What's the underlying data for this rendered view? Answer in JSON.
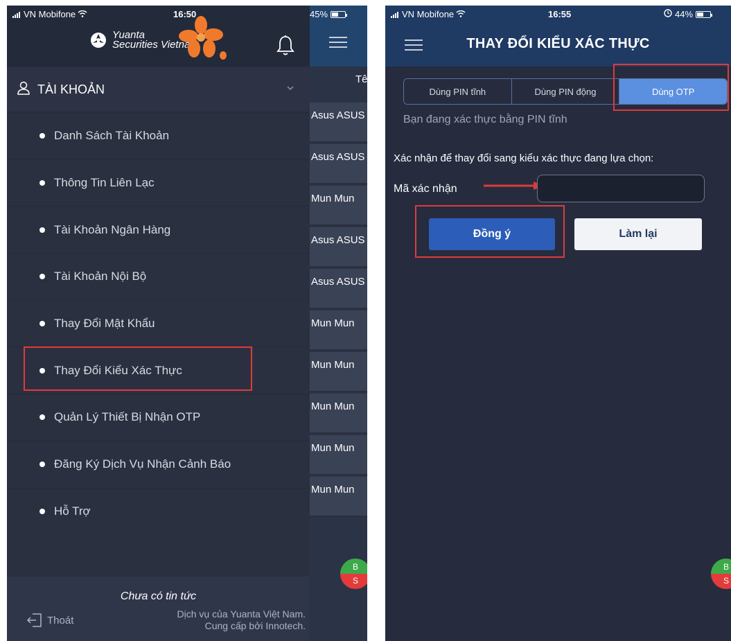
{
  "left_screen": {
    "status": {
      "carrier": "VN Mobifone",
      "time": "16:50",
      "battery": "45%",
      "battery_level": 0.45
    },
    "logo": {
      "line1": "Yuanta",
      "line2": "Securities Vietnam"
    },
    "section": {
      "title": "TÀI KHOẢN"
    },
    "menu": [
      {
        "label": "Danh Sách Tài Khoản"
      },
      {
        "label": "Thông Tin Liên Lạc"
      },
      {
        "label": "Tài Khoản Ngân Hàng"
      },
      {
        "label": "Tài Khoản Nội Bộ"
      },
      {
        "label": "Thay Đổi Mật Khẩu"
      },
      {
        "label": "Thay Đổi Kiểu Xác Thực"
      },
      {
        "label": "Quản Lý Thiết Bị Nhận OTP"
      },
      {
        "label": "Đăng Ký Dịch Vụ Nhận Cảnh Báo"
      },
      {
        "label": "Hỗ Trợ"
      }
    ],
    "footer": {
      "news": "Chưa có tin tức",
      "logout": "Thoát",
      "credit_line1": "Dịch vụ của Yuanta Việt Nam.",
      "credit_line2": "Cung cấp bởi Innotech."
    },
    "behind": {
      "column_header": "Tê",
      "rows": [
        "Asus ASUS",
        "Asus ASUS",
        "Mun Mun",
        "Asus ASUS",
        "Asus ASUS",
        "Mun Mun",
        "Mun Mun",
        "Mun Mun",
        "Mun Mun",
        "Mun Mun"
      ]
    },
    "trade_badge": {
      "buy": "B",
      "sell": "S"
    }
  },
  "right_screen": {
    "status": {
      "carrier": "VN Mobifone",
      "time": "16:55",
      "battery": "44%",
      "battery_level": 0.44
    },
    "title": "THAY ĐỔI KIỂU XÁC THỰC",
    "options": [
      {
        "label": "Dùng PIN tĩnh"
      },
      {
        "label": "Dùng PIN động"
      },
      {
        "label": "Dùng OTP"
      }
    ],
    "state_text": "Bạn đang xác thực bằng PIN tĩnh",
    "confirm_text": "Xác nhận để thay đổi sang kiểu xác thực đang lựa chọn:",
    "code_label": "Mã xác nhận",
    "code_value": "",
    "agree_button": "Đồng ý",
    "reset_button": "Làm lại",
    "trade_badge": {
      "buy": "B",
      "sell": "S"
    }
  },
  "colors": {
    "annotation": "#e03a3a",
    "selected_option": "#5b8fe0",
    "primary_button": "#2c5db8"
  }
}
